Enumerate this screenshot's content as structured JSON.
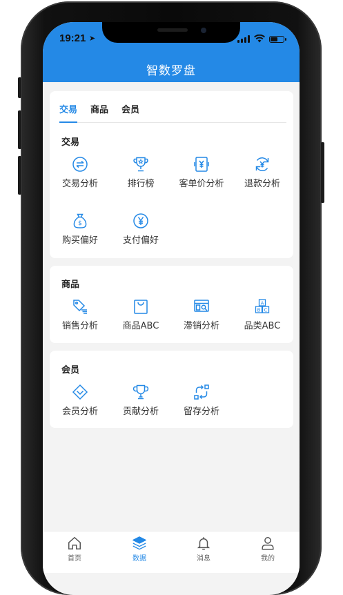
{
  "status_bar": {
    "time": "19:21"
  },
  "app": {
    "title": "智数罗盘"
  },
  "tabs": [
    {
      "label": "交易",
      "active": true
    },
    {
      "label": "商品",
      "active": false
    },
    {
      "label": "会员",
      "active": false
    }
  ],
  "sections": {
    "trade": {
      "title": "交易",
      "items": [
        {
          "label": "交易分析",
          "icon": "exchange-icon"
        },
        {
          "label": "排行榜",
          "icon": "trophy-star-icon"
        },
        {
          "label": "客单价分析",
          "icon": "yen-card-icon"
        },
        {
          "label": "退款分析",
          "icon": "refund-icon"
        },
        {
          "label": "购买偏好",
          "icon": "money-bag-icon"
        },
        {
          "label": "支付偏好",
          "icon": "yen-circle-icon"
        }
      ]
    },
    "goods": {
      "title": "商品",
      "items": [
        {
          "label": "销售分析",
          "icon": "price-tag-icon"
        },
        {
          "label": "商品ABC",
          "icon": "shopping-bag-icon"
        },
        {
          "label": "滞销分析",
          "icon": "slow-sales-search-icon"
        },
        {
          "label": "品类ABC",
          "icon": "abc-blocks-icon"
        }
      ]
    },
    "member": {
      "title": "会员",
      "items": [
        {
          "label": "会员分析",
          "icon": "diamond-icon"
        },
        {
          "label": "贡献分析",
          "icon": "trophy-icon"
        },
        {
          "label": "留存分析",
          "icon": "retention-cycle-icon"
        }
      ]
    }
  },
  "tabbar": [
    {
      "label": "首页",
      "icon": "home-icon",
      "active": false
    },
    {
      "label": "数据",
      "icon": "layers-icon",
      "active": true
    },
    {
      "label": "消息",
      "icon": "bell-icon",
      "active": false
    },
    {
      "label": "我的",
      "icon": "user-icon",
      "active": false
    }
  ],
  "colors": {
    "primary": "#2489e6",
    "background": "#f3f3f3"
  }
}
